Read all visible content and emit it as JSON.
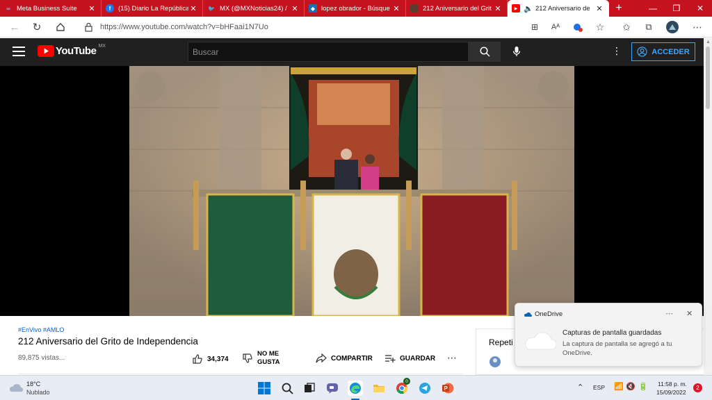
{
  "browser": {
    "tabs": [
      {
        "title": "Meta Business Suite",
        "icon": "meta-icon",
        "color": "#0668e1"
      },
      {
        "title": "(15) Diario La República",
        "icon": "facebook-icon",
        "color": "#1877f2"
      },
      {
        "title": "MX (@MXNoticias24) /",
        "icon": "twitter-icon",
        "color": "#1da1f2"
      },
      {
        "title": "lopez obrador - Búsque",
        "icon": "tweetdeck-icon",
        "color": "#1a6fb0"
      },
      {
        "title": "212 Aniversario del Grit",
        "icon": "thumbnail-icon",
        "color": "#5a3d2e"
      },
      {
        "title": "212 Aniversario de",
        "icon": "youtube-icon",
        "color": "#ff0000"
      }
    ],
    "url": "https://www.youtube.com/watch?v=bHFaai1N7Uo"
  },
  "youtube": {
    "logo_text": "YouTube",
    "region": "MX",
    "search_placeholder": "Buscar",
    "signin_label": "ACCEDER",
    "hashtags": "#EnVivo #AMLO",
    "video_title": "212 Aniversario del Grito de Independencia",
    "views": "89,875 vistas...",
    "likes": "34,374",
    "dislike_label_1": "NO ME",
    "dislike_label_2": "GUSTA",
    "share_label": "COMPARTIR",
    "save_label": "GUARDAR",
    "side_label": "Repeti"
  },
  "toast": {
    "app": "OneDrive",
    "title": "Capturas de pantalla guardadas",
    "body": "La captura de pantalla se agregó a tu OneDrive."
  },
  "taskbar": {
    "temp": "18°C",
    "weather": "Nublado",
    "lang": "ESP",
    "time": "11:58 p. m.",
    "date": "15/09/2022",
    "notifications": "2",
    "chrome_badge": "0"
  }
}
